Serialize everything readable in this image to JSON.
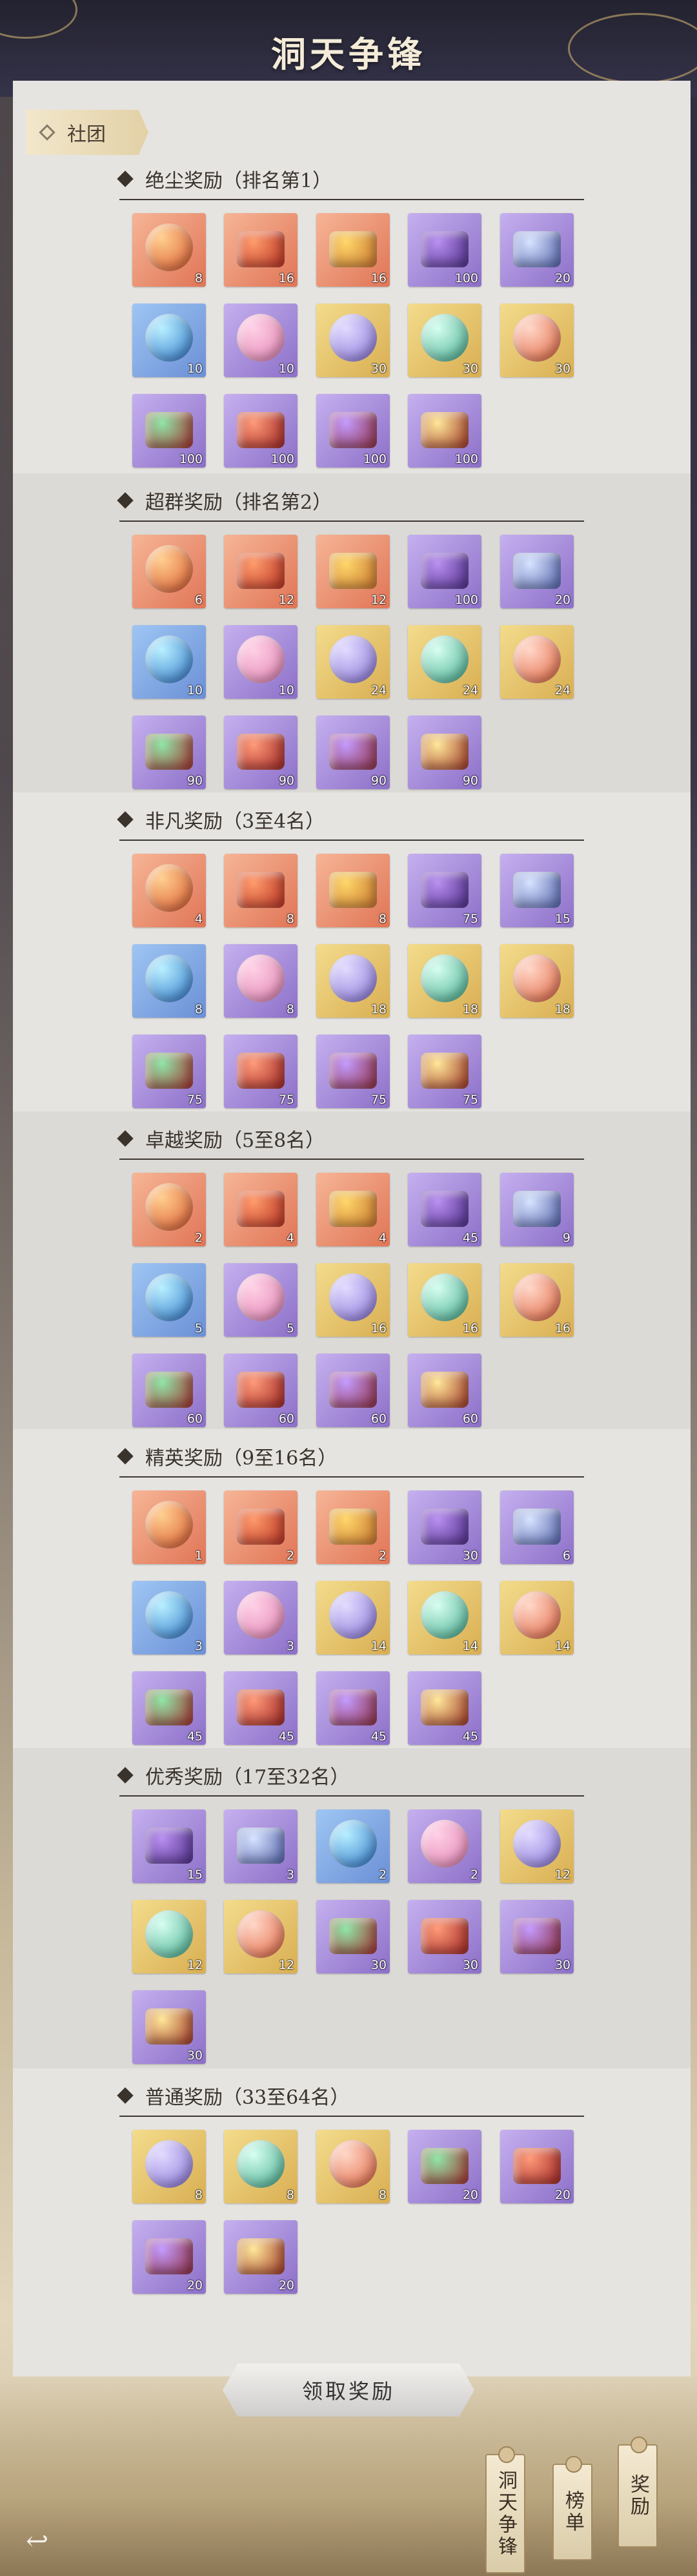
{
  "page_title": "洞天争锋",
  "tag_label": "社团",
  "sections": [
    {
      "title": "绝尘奖励（排名第1）",
      "items": [
        {
          "icon": "lotus-lamp",
          "color": "orange",
          "count": "8"
        },
        {
          "icon": "red-lantern",
          "color": "orange",
          "count": "16"
        },
        {
          "icon": "golden-book",
          "color": "orange",
          "count": "16"
        },
        {
          "icon": "crystal-orb-stand",
          "color": "purple",
          "count": "100"
        },
        {
          "icon": "jade-chest",
          "color": "purple",
          "count": "20"
        },
        {
          "icon": "blue-spirit-orb",
          "color": "blue",
          "count": "10"
        },
        {
          "icon": "pink-lotus",
          "color": "purple",
          "count": "10"
        },
        {
          "icon": "purple-gem-pot",
          "color": "gold",
          "count": "30"
        },
        {
          "icon": "green-gem-pot",
          "color": "gold",
          "count": "30"
        },
        {
          "icon": "red-gem-pot",
          "color": "gold",
          "count": "30"
        },
        {
          "icon": "green-gem-chest",
          "color": "purple",
          "count": "100"
        },
        {
          "icon": "red-gem-chest",
          "color": "purple",
          "count": "100"
        },
        {
          "icon": "purple-gem-chest",
          "color": "purple",
          "count": "100"
        },
        {
          "icon": "gold-gem-chest",
          "color": "purple",
          "count": "100"
        }
      ]
    },
    {
      "title": "超群奖励（排名第2）",
      "items": [
        {
          "icon": "lotus-lamp",
          "color": "orange",
          "count": "6"
        },
        {
          "icon": "red-lantern",
          "color": "orange",
          "count": "12"
        },
        {
          "icon": "golden-book",
          "color": "orange",
          "count": "12"
        },
        {
          "icon": "crystal-orb-stand",
          "color": "purple",
          "count": "100"
        },
        {
          "icon": "jade-chest",
          "color": "purple",
          "count": "20"
        },
        {
          "icon": "blue-spirit-orb",
          "color": "blue",
          "count": "10"
        },
        {
          "icon": "pink-lotus",
          "color": "purple",
          "count": "10"
        },
        {
          "icon": "purple-gem-pot",
          "color": "gold",
          "count": "24"
        },
        {
          "icon": "green-gem-pot",
          "color": "gold",
          "count": "24"
        },
        {
          "icon": "red-gem-pot",
          "color": "gold",
          "count": "24"
        },
        {
          "icon": "green-gem-chest",
          "color": "purple",
          "count": "90"
        },
        {
          "icon": "red-gem-chest",
          "color": "purple",
          "count": "90"
        },
        {
          "icon": "purple-gem-chest",
          "color": "purple",
          "count": "90"
        },
        {
          "icon": "gold-gem-chest",
          "color": "purple",
          "count": "90"
        }
      ]
    },
    {
      "title": "非凡奖励（3至4名）",
      "items": [
        {
          "icon": "lotus-lamp",
          "color": "orange",
          "count": "4"
        },
        {
          "icon": "red-lantern",
          "color": "orange",
          "count": "8"
        },
        {
          "icon": "golden-book",
          "color": "orange",
          "count": "8"
        },
        {
          "icon": "crystal-orb-stand",
          "color": "purple",
          "count": "75"
        },
        {
          "icon": "jade-chest",
          "color": "purple",
          "count": "15"
        },
        {
          "icon": "blue-spirit-orb",
          "color": "blue",
          "count": "8"
        },
        {
          "icon": "pink-lotus",
          "color": "purple",
          "count": "8"
        },
        {
          "icon": "purple-gem-pot",
          "color": "gold",
          "count": "18"
        },
        {
          "icon": "green-gem-pot",
          "color": "gold",
          "count": "18"
        },
        {
          "icon": "red-gem-pot",
          "color": "gold",
          "count": "18"
        },
        {
          "icon": "green-gem-chest",
          "color": "purple",
          "count": "75"
        },
        {
          "icon": "red-gem-chest",
          "color": "purple",
          "count": "75"
        },
        {
          "icon": "purple-gem-chest",
          "color": "purple",
          "count": "75"
        },
        {
          "icon": "gold-gem-chest",
          "color": "purple",
          "count": "75"
        }
      ]
    },
    {
      "title": "卓越奖励（5至8名）",
      "items": [
        {
          "icon": "lotus-lamp",
          "color": "orange",
          "count": "2"
        },
        {
          "icon": "red-lantern",
          "color": "orange",
          "count": "4"
        },
        {
          "icon": "golden-book",
          "color": "orange",
          "count": "4"
        },
        {
          "icon": "crystal-orb-stand",
          "color": "purple",
          "count": "45"
        },
        {
          "icon": "jade-chest",
          "color": "purple",
          "count": "9"
        },
        {
          "icon": "blue-spirit-orb",
          "color": "blue",
          "count": "5"
        },
        {
          "icon": "pink-lotus",
          "color": "purple",
          "count": "5"
        },
        {
          "icon": "purple-gem-pot",
          "color": "gold",
          "count": "16"
        },
        {
          "icon": "green-gem-pot",
          "color": "gold",
          "count": "16"
        },
        {
          "icon": "red-gem-pot",
          "color": "gold",
          "count": "16"
        },
        {
          "icon": "green-gem-chest",
          "color": "purple",
          "count": "60"
        },
        {
          "icon": "red-gem-chest",
          "color": "purple",
          "count": "60"
        },
        {
          "icon": "purple-gem-chest",
          "color": "purple",
          "count": "60"
        },
        {
          "icon": "gold-gem-chest",
          "color": "purple",
          "count": "60"
        }
      ]
    },
    {
      "title": "精英奖励（9至16名）",
      "items": [
        {
          "icon": "lotus-lamp",
          "color": "orange",
          "count": "1"
        },
        {
          "icon": "red-lantern",
          "color": "orange",
          "count": "2"
        },
        {
          "icon": "golden-book",
          "color": "orange",
          "count": "2"
        },
        {
          "icon": "crystal-orb-stand",
          "color": "purple",
          "count": "30"
        },
        {
          "icon": "jade-chest",
          "color": "purple",
          "count": "6"
        },
        {
          "icon": "blue-spirit-orb",
          "color": "blue",
          "count": "3"
        },
        {
          "icon": "pink-lotus",
          "color": "purple",
          "count": "3"
        },
        {
          "icon": "purple-gem-pot",
          "color": "gold",
          "count": "14"
        },
        {
          "icon": "green-gem-pot",
          "color": "gold",
          "count": "14"
        },
        {
          "icon": "red-gem-pot",
          "color": "gold",
          "count": "14"
        },
        {
          "icon": "green-gem-chest",
          "color": "purple",
          "count": "45"
        },
        {
          "icon": "red-gem-chest",
          "color": "purple",
          "count": "45"
        },
        {
          "icon": "purple-gem-chest",
          "color": "purple",
          "count": "45"
        },
        {
          "icon": "gold-gem-chest",
          "color": "purple",
          "count": "45"
        }
      ]
    },
    {
      "title": "优秀奖励（17至32名）",
      "items": [
        {
          "icon": "crystal-orb-stand",
          "color": "purple",
          "count": "15"
        },
        {
          "icon": "jade-chest",
          "color": "purple",
          "count": "3"
        },
        {
          "icon": "blue-spirit-orb",
          "color": "blue",
          "count": "2"
        },
        {
          "icon": "pink-lotus",
          "color": "purple",
          "count": "2"
        },
        {
          "icon": "purple-gem-pot",
          "color": "gold",
          "count": "12"
        },
        {
          "icon": "green-gem-pot",
          "color": "gold",
          "count": "12"
        },
        {
          "icon": "red-gem-pot",
          "color": "gold",
          "count": "12"
        },
        {
          "icon": "green-gem-chest",
          "color": "purple",
          "count": "30"
        },
        {
          "icon": "red-gem-chest",
          "color": "purple",
          "count": "30"
        },
        {
          "icon": "purple-gem-chest",
          "color": "purple",
          "count": "30"
        },
        {
          "icon": "gold-gem-chest",
          "color": "purple",
          "count": "30"
        }
      ]
    },
    {
      "title": "普通奖励（33至64名）",
      "items": [
        {
          "icon": "purple-gem-pot",
          "color": "gold",
          "count": "8"
        },
        {
          "icon": "green-gem-pot",
          "color": "gold",
          "count": "8"
        },
        {
          "icon": "red-gem-pot",
          "color": "gold",
          "count": "8"
        },
        {
          "icon": "green-gem-chest",
          "color": "purple",
          "count": "20"
        },
        {
          "icon": "red-gem-chest",
          "color": "purple",
          "count": "20"
        },
        {
          "icon": "purple-gem-chest",
          "color": "purple",
          "count": "20"
        },
        {
          "icon": "gold-gem-chest",
          "color": "purple",
          "count": "20"
        }
      ]
    }
  ],
  "claim_button": "领取奖励",
  "side_tabs": [
    "洞天争锋",
    "榜单",
    "奖励"
  ],
  "back_icon": "back-arrow-icon",
  "colors": {
    "orange": "#e07556",
    "purple": "#8c6fc8",
    "blue": "#6b8fd6",
    "gold": "#d9ae52"
  }
}
